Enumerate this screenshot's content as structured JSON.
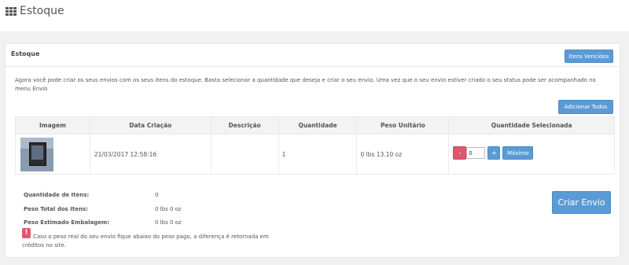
{
  "header": {
    "title": "Estoque",
    "icon": "grid-icon"
  },
  "panel": {
    "title": "Estoque",
    "expired_button": "Itens Vencidos",
    "intro": "Agora você pode criar os seus envios com os seus itens do estoque. Basta selecionar a quantidade que deseja e criar o seu envio. Uma vez que o seu envio estiver criado o seu status pode ser acompanhado no menu Envio",
    "add_all_button": "Adicionar Todos"
  },
  "table": {
    "headers": [
      "Imagem",
      "Data Criação",
      "Descrição",
      "Quantidade",
      "Peso Unitário",
      "Quantidade Selecionada"
    ],
    "rows": [
      {
        "date": "21/03/2017 12:58:16",
        "description": "",
        "quantity": "1",
        "unit_weight": "0 lbs 13.10 oz",
        "selected_qty": "0",
        "minus": "-",
        "plus": "+",
        "max": "Máximo"
      }
    ]
  },
  "summary": {
    "items_label": "Quantidade de Itens:",
    "items_value": "0",
    "total_weight_label": "Peso Total dos Itens:",
    "total_weight_value": "0 lbs 0 oz",
    "packaging_label": "Peso Estimado Embalagem:",
    "packaging_value": "0 lbs 0 oz",
    "create_button": "Criar Envio"
  },
  "warning": {
    "icon_glyph": "!",
    "text": "Caso o peso real do seu envio fique abaixo do peso pago, a diferença é retornada em créditos no site."
  },
  "colors": {
    "primary": "#5b9bd5",
    "danger": "#e0566c"
  }
}
